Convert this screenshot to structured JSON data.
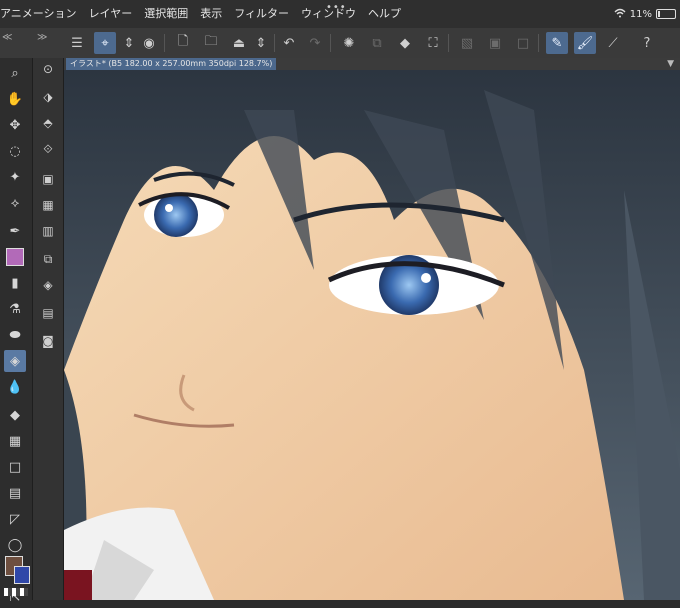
{
  "menubar": {
    "items": [
      "アニメーション",
      "レイヤー",
      "選択範囲",
      "表示",
      "フィルター",
      "ウィンドウ",
      "ヘルプ"
    ],
    "battery": "11%",
    "wifi_icon": "wifi-icon"
  },
  "toolbar": {
    "icons": [
      "menu-icon",
      "ruler-icon",
      "stepper-icon",
      "eye-icon",
      "new-file-icon",
      "open-folder-icon",
      "save-icon",
      "stepper-icon",
      "undo-icon",
      "redo-icon",
      "loading-icon",
      "copy-icon",
      "fill-icon",
      "crop-icon",
      "transform-icon",
      "layer-icon",
      "invert-icon",
      "pen-icon",
      "brush-icon",
      "line-icon",
      "help-icon"
    ]
  },
  "canvas_tab": {
    "label": "イラスト* (B5 182.00 x 257.00mm 350dpi 128.7%)"
  },
  "left_tools": {
    "top_glyphs": [
      "≪",
      "≫"
    ],
    "icons": [
      "zoom-icon",
      "hand-icon",
      "move-icon",
      "lasso-icon",
      "magic-wand-icon",
      "eyedropper-icon",
      "pen-icon",
      "avatar-icon",
      "marker-icon",
      "airbrush-icon",
      "blend-icon",
      "eraser-icon",
      "drop-icon",
      "fill-icon",
      "gradient-icon",
      "rectangle-icon",
      "grid-icon",
      "line-icon",
      "balloon-icon",
      "text-icon",
      "select-icon"
    ]
  },
  "colors": {
    "accent": "#5a7aa3",
    "foreground_color": "#6e4f3f",
    "background_color": "#2f47a8"
  }
}
